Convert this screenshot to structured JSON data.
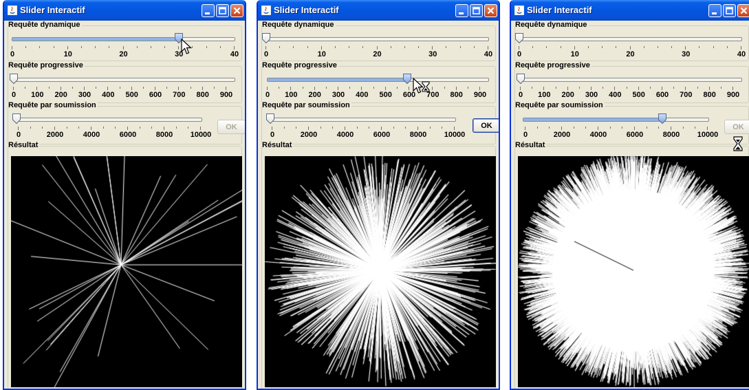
{
  "windows": [
    {
      "title": "Slider Interactif",
      "sliders": [
        {
          "label": "Requête dynamique",
          "ticks": [
            "0",
            "10",
            "20",
            "30",
            "40"
          ],
          "max": 40,
          "value": 30
        },
        {
          "label": "Requête progressive",
          "ticks": [
            "0",
            "100",
            "200",
            "300",
            "400",
            "500",
            "600",
            "700",
            "800",
            "900"
          ],
          "max": 950,
          "value": 0
        },
        {
          "label": "Requête par soumission",
          "ticks": [
            "0",
            "2000",
            "4000",
            "6000",
            "8000",
            "10000"
          ],
          "max": 10000,
          "value": 0
        }
      ],
      "ok_label": "OK",
      "ok_state": "disabled",
      "result_label": "Résultat",
      "result_state": "sparse rays",
      "cursor": "arrow"
    },
    {
      "title": "Slider Interactif",
      "sliders": [
        {
          "label": "Requête dynamique",
          "ticks": [
            "0",
            "10",
            "20",
            "30",
            "40"
          ],
          "max": 40,
          "value": 0
        },
        {
          "label": "Requête progressive",
          "ticks": [
            "0",
            "100",
            "200",
            "300",
            "400",
            "500",
            "600",
            "700",
            "800",
            "900"
          ],
          "max": 950,
          "value": 600
        },
        {
          "label": "Requête par soumission",
          "ticks": [
            "0",
            "2000",
            "4000",
            "6000",
            "8000",
            "10000"
          ],
          "max": 10000,
          "value": 0
        }
      ],
      "ok_label": "OK",
      "ok_state": "enabled",
      "result_label": "Résultat",
      "result_state": "dense rays",
      "cursor": "arrow-busy"
    },
    {
      "title": "Slider Interactif",
      "sliders": [
        {
          "label": "Requête dynamique",
          "ticks": [
            "0",
            "10",
            "20",
            "30",
            "40"
          ],
          "max": 40,
          "value": 0
        },
        {
          "label": "Requête progressive",
          "ticks": [
            "0",
            "100",
            "200",
            "300",
            "400",
            "500",
            "600",
            "700",
            "800",
            "900"
          ],
          "max": 950,
          "value": 0
        },
        {
          "label": "Requête par soumission",
          "ticks": [
            "0",
            "2000",
            "4000",
            "6000",
            "8000",
            "10000"
          ],
          "max": 10000,
          "value": 7500
        }
      ],
      "ok_label": "OK",
      "ok_state": "disabled",
      "result_label": "Résultat",
      "result_state": "saturated rays",
      "cursor": "hourglass"
    }
  ],
  "colors": {
    "titlebar": "#0a5fe8",
    "window_bg": "#ece9d8",
    "canvas_bg": "#000000",
    "rays": "#ffffff"
  }
}
